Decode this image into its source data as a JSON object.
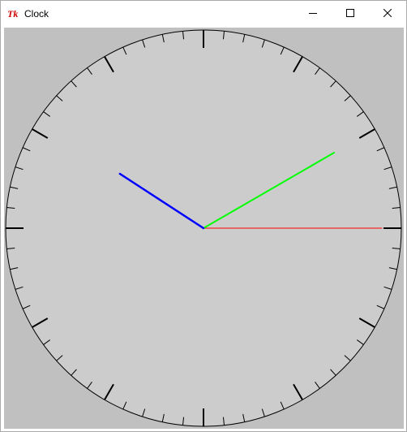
{
  "window": {
    "title": "Clock",
    "app_icon": "tk-feather-icon",
    "controls": {
      "minimize_icon": "minimize-icon",
      "maximize_icon": "maximize-icon",
      "close_icon": "close-icon"
    }
  },
  "clock": {
    "face_color": "#cccccc",
    "background_color": "#c0c0c0",
    "hands": {
      "hour": {
        "color": "#0000ff",
        "angle_deg": 303
      },
      "minute": {
        "color": "#00ff00",
        "angle_deg": 60
      },
      "second": {
        "color": "#ff0000",
        "angle_deg": 90
      }
    },
    "tick_count": 60,
    "major_tick_every": 5
  }
}
